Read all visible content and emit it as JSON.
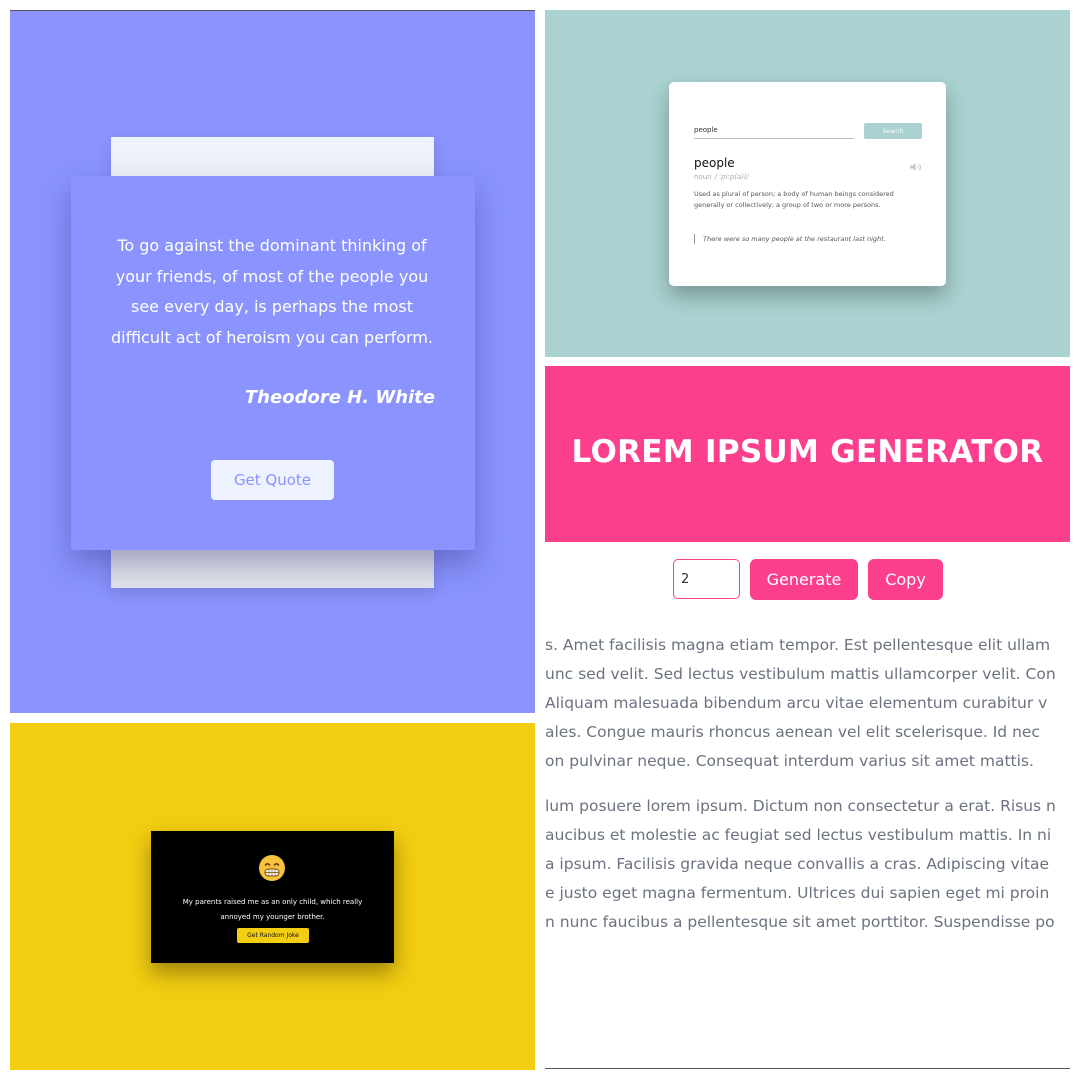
{
  "quote_app": {
    "quote": "To go against the dominant thinking of your friends, of most of the people you see every day, is perhaps the most difficult act of heroism you can perform.",
    "author": "Theodore H. White",
    "button_label": "Get Quote",
    "colors": {
      "background": "#8a93fe",
      "button_bg": "#eef2ff"
    }
  },
  "dictionary_app": {
    "search_value": "people",
    "search_button_label": "Search",
    "word": "people",
    "part_of_speech": "noun",
    "phonetic": "/ ˈpiːp(ə)l/",
    "definition": "Used as plural of person; a body of human beings considered generally or collectively; a group of two or more persons.",
    "example": "There were so many people at the restaurant last night.",
    "speaker_icon": "speaker-icon",
    "colors": {
      "background": "#a9d2d0"
    }
  },
  "lorem_app": {
    "title": "LOREM IPSUM GENERATOR",
    "count_value": "2",
    "generate_label": "Generate",
    "copy_label": "Copy",
    "lines": [
      "s. Amet facilisis magna etiam tempor. Est pellentesque elit ullam",
      "unc sed velit. Sed lectus vestibulum mattis ullamcorper velit. Con",
      "Aliquam malesuada bibendum arcu vitae elementum curabitur v",
      "ales. Congue mauris rhoncus aenean vel elit scelerisque. Id nec",
      "on pulvinar neque. Consequat interdum varius sit amet mattis.",
      "lum posuere lorem ipsum. Dictum non consectetur a erat. Risus n",
      "aucibus et molestie ac feugiat sed lectus vestibulum mattis. In ni",
      "a ipsum. Facilisis gravida neque convallis a cras. Adipiscing vitae",
      "e justo eget magna fermentum. Ultrices dui sapien eget mi proin",
      "n nunc faucibus a pellentesque sit amet porttitor. Suspendisse po"
    ],
    "colors": {
      "accent": "#fb3f8c",
      "text": "#6b7280"
    }
  },
  "joke_app": {
    "emoji_icon": "grinning-face-icon",
    "joke": "My parents raised me as an only child, which really annoyed my younger brother.",
    "button_label": "Get Random Joke",
    "colors": {
      "background": "#f2cd11",
      "card": "#000000"
    }
  }
}
